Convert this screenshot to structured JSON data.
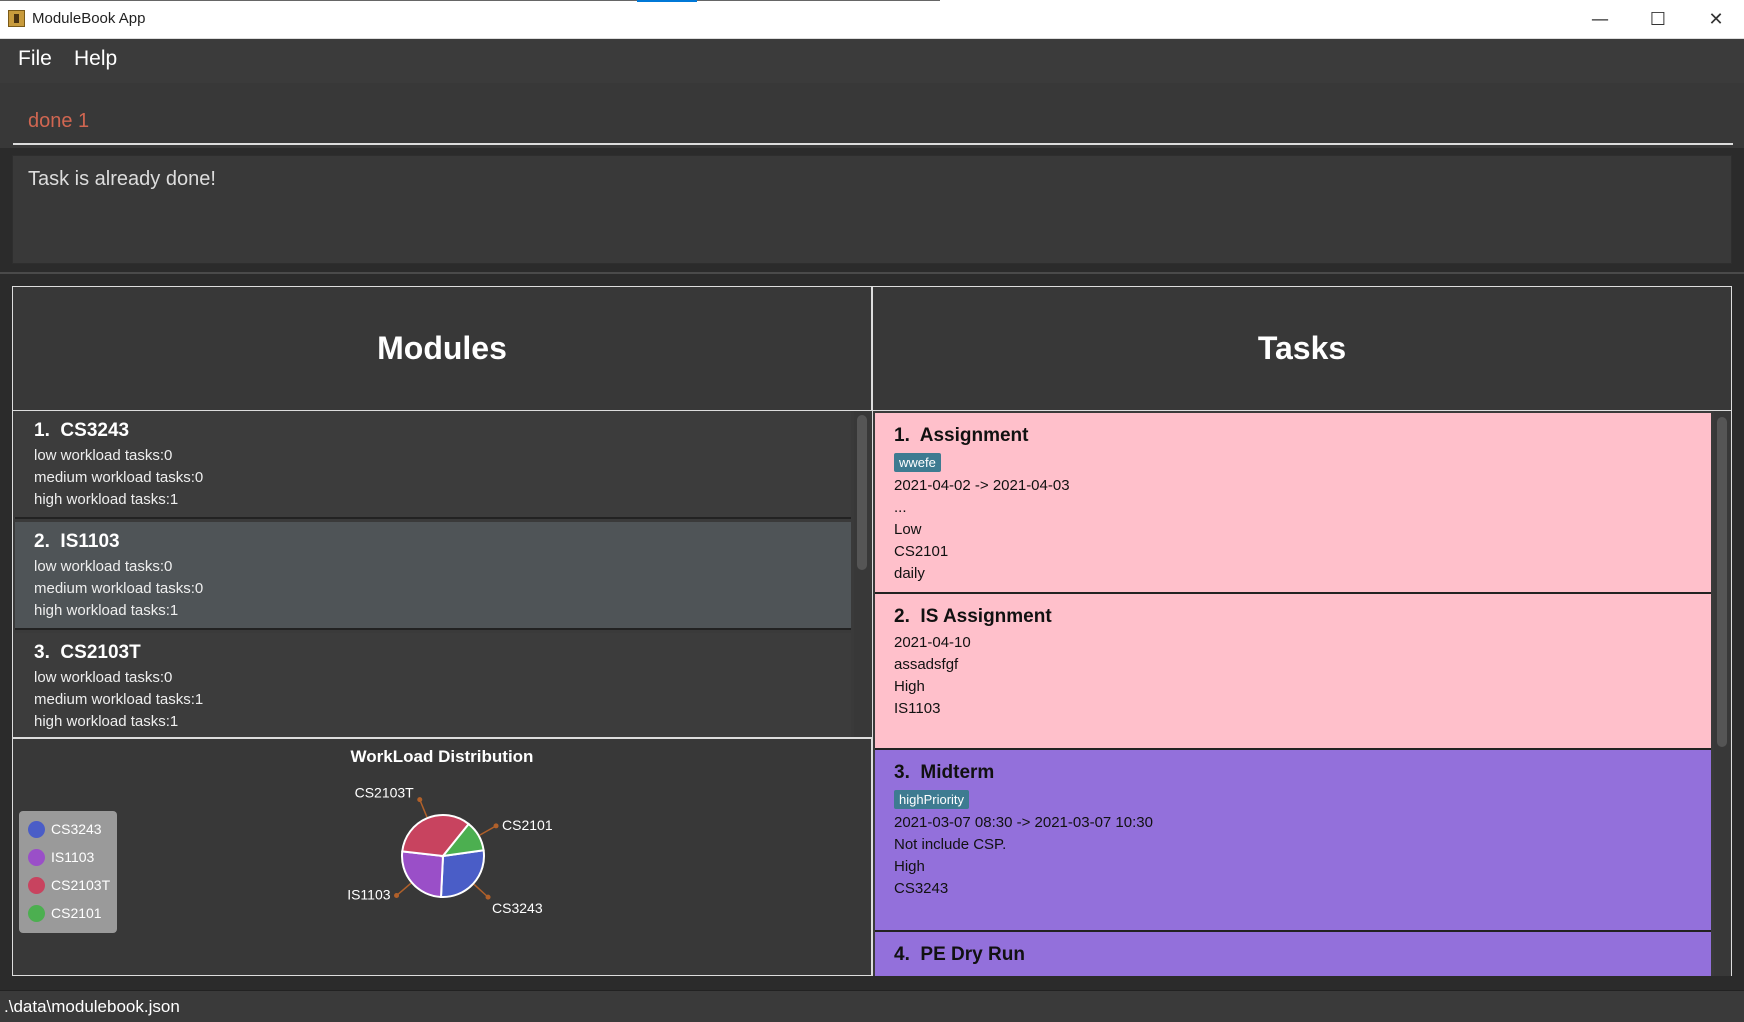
{
  "window": {
    "title": "ModuleBook App"
  },
  "menu": {
    "file": "File",
    "help": "Help"
  },
  "command": {
    "value": "done 1"
  },
  "result": {
    "text": "Task is already done!"
  },
  "modules_panel": {
    "title": "Modules",
    "items": [
      {
        "index": "1.",
        "name": "CS3243",
        "low": "low workload tasks:0",
        "medium": "medium workload tasks:0",
        "high": "high workload tasks:1"
      },
      {
        "index": "2.",
        "name": "IS1103",
        "low": "low workload tasks:0",
        "medium": "medium workload tasks:0",
        "high": "high workload tasks:1"
      },
      {
        "index": "3.",
        "name": "CS2103T",
        "low": "low workload tasks:0",
        "medium": "medium workload tasks:1",
        "high": "high workload tasks:1"
      }
    ]
  },
  "chart_data": {
    "type": "pie",
    "title": "WorkLoad Distribution",
    "categories": [
      "CS3243",
      "IS1103",
      "CS2103T",
      "CS2101"
    ],
    "values": [
      28,
      26,
      34,
      12
    ],
    "colors": [
      "#4a5dc7",
      "#9a4fc8",
      "#c8435f",
      "#4caf50"
    ],
    "legend_position": "left"
  },
  "tasks_panel": {
    "title": "Tasks",
    "items": [
      {
        "index": "1.",
        "name": "Assignment",
        "tag": "wwefe",
        "date": "2021-04-02 -> 2021-04-03",
        "desc": "...",
        "workload": "Low",
        "module": "CS2101",
        "recurrence": "daily"
      },
      {
        "index": "2.",
        "name": "IS Assignment",
        "date": "2021-04-10",
        "desc": "assadsfgf",
        "workload": "High",
        "module": "IS1103"
      },
      {
        "index": "3.",
        "name": "Midterm",
        "tag": "highPriority",
        "date": "2021-03-07 08:30 -> 2021-03-07 10:30",
        "desc": "Not include CSP.",
        "workload": "High",
        "module": "CS3243"
      },
      {
        "index": "4.",
        "name": "PE Dry Run"
      }
    ]
  },
  "status": {
    "path": ".\\data\\modulebook.json"
  },
  "colors": {
    "pink_card": "#ffc0cb",
    "purple_card": "#9370db",
    "tag": "#3e7b91",
    "command_text": "#d06651"
  }
}
